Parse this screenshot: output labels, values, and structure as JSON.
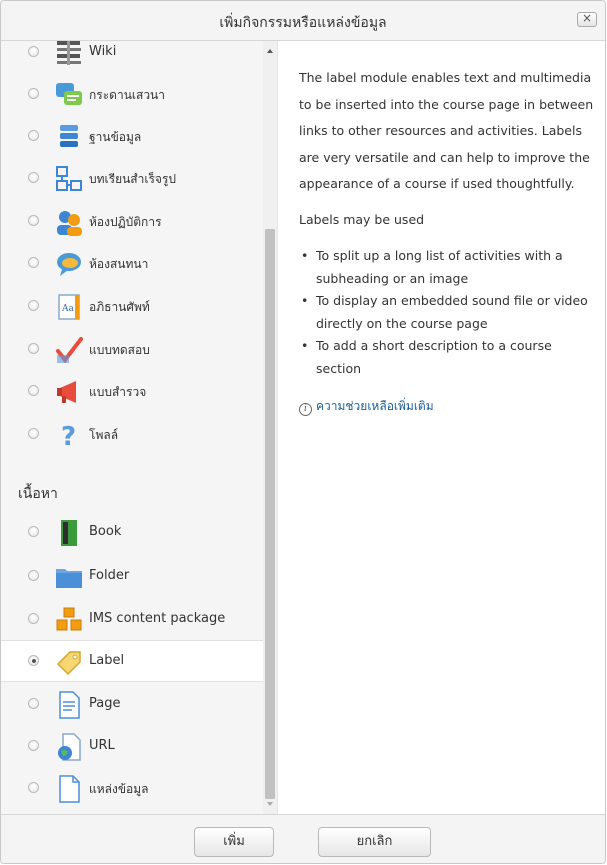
{
  "dialog": {
    "title": "เพิ่มกิจกรรมหรือแหล่งข้อมูล",
    "close_symbol": "×"
  },
  "modules": [
    {
      "label": "Wiki",
      "icon": "wiki-icon",
      "selected": false
    },
    {
      "label": "กระดานเสวนา",
      "icon": "forum-icon",
      "selected": false
    },
    {
      "label": "ฐานข้อมูล",
      "icon": "database-icon",
      "selected": false
    },
    {
      "label": "บทเรียนสำเร็จรูป",
      "icon": "lesson-icon",
      "selected": false
    },
    {
      "label": "ห้องปฏิบัติการ",
      "icon": "workshop-icon",
      "selected": false
    },
    {
      "label": "ห้องสนทนา",
      "icon": "chat-icon",
      "selected": false
    },
    {
      "label": "อภิธานศัพท์",
      "icon": "glossary-icon",
      "selected": false
    },
    {
      "label": "แบบทดสอบ",
      "icon": "quiz-icon",
      "selected": false
    },
    {
      "label": "แบบสำรวจ",
      "icon": "survey-icon",
      "selected": false
    },
    {
      "label": "โพลล์",
      "icon": "choice-icon",
      "selected": false
    }
  ],
  "resources_heading": "เนื้อหา",
  "resources": [
    {
      "label": "Book",
      "icon": "book-icon",
      "selected": false
    },
    {
      "label": "Folder",
      "icon": "folder-icon",
      "selected": false
    },
    {
      "label": "IMS content package",
      "icon": "ims-package-icon",
      "selected": false
    },
    {
      "label": "Label",
      "icon": "label-tag-icon",
      "selected": true
    },
    {
      "label": "Page",
      "icon": "page-icon",
      "selected": false
    },
    {
      "label": "URL",
      "icon": "url-icon",
      "selected": false
    },
    {
      "label": "แหล่งข้อมูล",
      "icon": "file-icon",
      "selected": false
    }
  ],
  "help_panel": {
    "description": "The label module enables text and multimedia to be inserted into the course page in between links to other resources and activities. Labels are very versatile and can help to improve the appearance of a course if used thoughtfully.",
    "may_be_used": "Labels may be used",
    "bullets": [
      "To split up a long list of activities with a subheading or an image",
      "To display an embedded sound file or video directly on the course page",
      "To add a short description to a course section"
    ],
    "more_help_link": "ความช่วยเหลือเพิ่มเติม",
    "info_symbol": "i"
  },
  "footer": {
    "add_label": "เพิ่ม",
    "cancel_label": "ยกเลิก"
  }
}
